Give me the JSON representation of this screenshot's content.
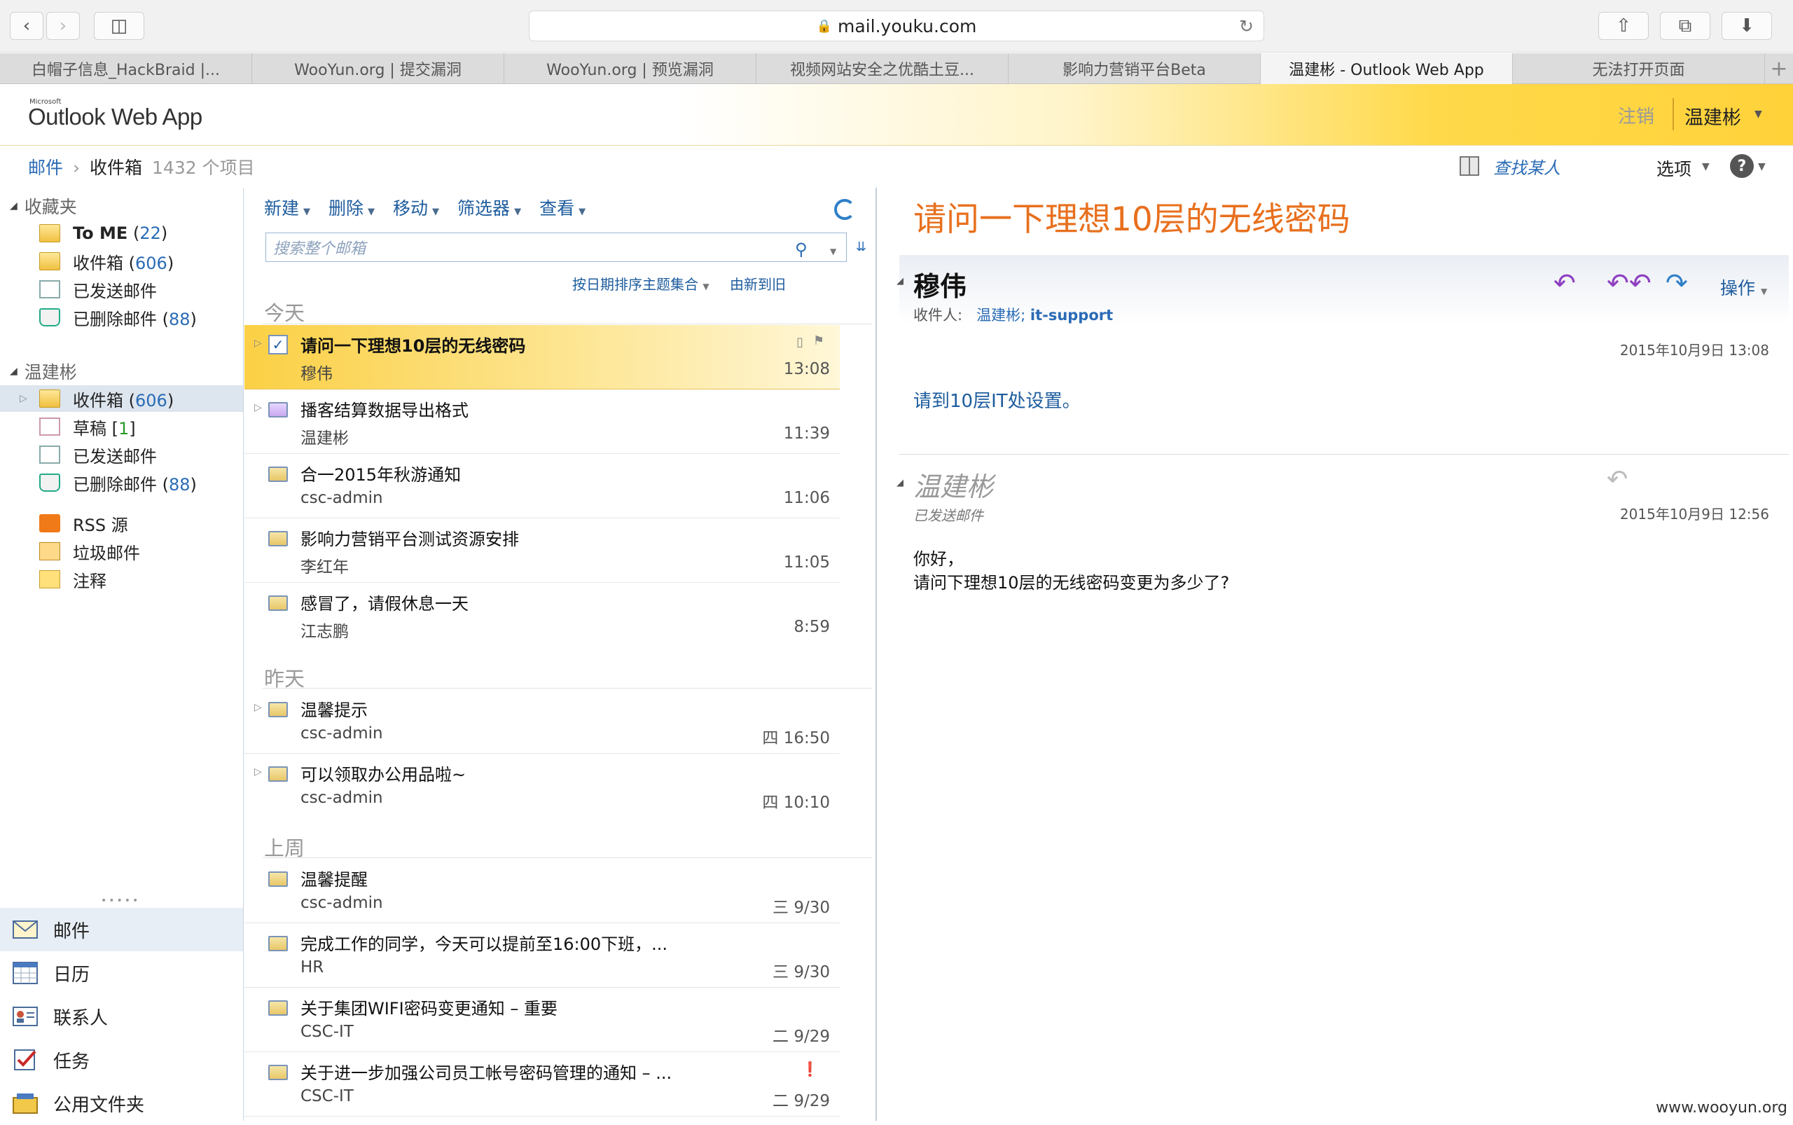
{
  "browser": {
    "url": "mail.youku.com",
    "tabs": [
      {
        "label": "白帽子信息_HackBraid |..."
      },
      {
        "label": "WooYun.org | 提交漏洞"
      },
      {
        "label": "WooYun.org | 预览漏洞"
      },
      {
        "label": "视频网站安全之优酷土豆..."
      },
      {
        "label": "影响力营销平台Beta"
      },
      {
        "label": "温建彬 - Outlook Web App"
      },
      {
        "label": "无法打开页面"
      }
    ]
  },
  "header": {
    "brand_small": "Microsoft",
    "brand": "Outlook Web App",
    "logout": "注销",
    "user": "温建彬"
  },
  "breadcrumb": {
    "root": "邮件",
    "folder": "收件箱",
    "count": "1432 个项目"
  },
  "topright": {
    "find": "查找某人",
    "options": "选项"
  },
  "nav": {
    "favorites": "收藏夹",
    "fav_items": [
      {
        "label": "To ME",
        "count": "22"
      },
      {
        "label": "收件箱",
        "count": "606"
      },
      {
        "label": "已发送邮件"
      },
      {
        "label": "已删除邮件",
        "count": "88"
      }
    ],
    "mailbox": "温建彬",
    "box_items": [
      {
        "label": "收件箱",
        "count": "606"
      },
      {
        "label": "草稿",
        "count": "1"
      },
      {
        "label": "已发送邮件"
      },
      {
        "label": "已删除邮件",
        "count": "88"
      },
      {
        "label": "RSS 源"
      },
      {
        "label": "垃圾邮件"
      },
      {
        "label": "注释"
      }
    ],
    "bottom": [
      {
        "label": "邮件"
      },
      {
        "label": "日历"
      },
      {
        "label": "联系人"
      },
      {
        "label": "任务"
      },
      {
        "label": "公用文件夹"
      }
    ]
  },
  "list": {
    "toolbar": {
      "new": "新建",
      "delete": "删除",
      "move": "移动",
      "filter": "筛选器",
      "view": "查看"
    },
    "search_placeholder": "搜索整个邮箱",
    "sort": "按日期排序主题集合",
    "order": "由新到旧",
    "groups": {
      "today": "今天",
      "yesterday": "昨天",
      "lastweek": "上周"
    },
    "items": [
      {
        "subject": "请问一下理想10层的无线密码",
        "from": "穆伟",
        "time": "13:08"
      },
      {
        "subject": "播客结算数据导出格式",
        "from": "温建彬",
        "time": "11:39"
      },
      {
        "subject": "合一2015年秋游通知",
        "from": "csc-admin",
        "time": "11:06"
      },
      {
        "subject": "影响力营销平台测试资源安排",
        "from": "李红年",
        "time": "11:05"
      },
      {
        "subject": "感冒了，请假休息一天",
        "from": "江志鹏",
        "time": "8:59"
      },
      {
        "subject": "温馨提示",
        "from": "csc-admin",
        "time": "四 16:50"
      },
      {
        "subject": "可以领取办公用品啦~",
        "from": "csc-admin",
        "time": "四 10:10"
      },
      {
        "subject": "温馨提醒",
        "from": "csc-admin",
        "time": "三 9/30"
      },
      {
        "subject": "完成工作的同学，今天可以提前至16:00下班，...",
        "from": "HR",
        "time": "三 9/30"
      },
      {
        "subject": "关于集团WIFI密码变更通知 – 重要",
        "from": "CSC-IT",
        "time": "二 9/29"
      },
      {
        "subject": "关于进一步加强公司员工帐号密码管理的通知 – ...",
        "from": "CSC-IT",
        "time": "二 9/29"
      }
    ]
  },
  "reading": {
    "subject": "请问一下理想10层的无线密码",
    "sender": "穆伟",
    "to_label": "收件人:",
    "to_1": "温建彬;",
    "to_2": "it-support",
    "action": "操作",
    "date1": "2015年10月9日 13:08",
    "body1": "请到10层IT处设置。",
    "sender2": "温建彬",
    "folder2": "已发送邮件",
    "date2": "2015年10月9日 12:56",
    "body2_line1": "你好，",
    "body2_line2": "请问下理想10层的无线密码变更为多少了?"
  },
  "watermark": "www.wooyun.org"
}
